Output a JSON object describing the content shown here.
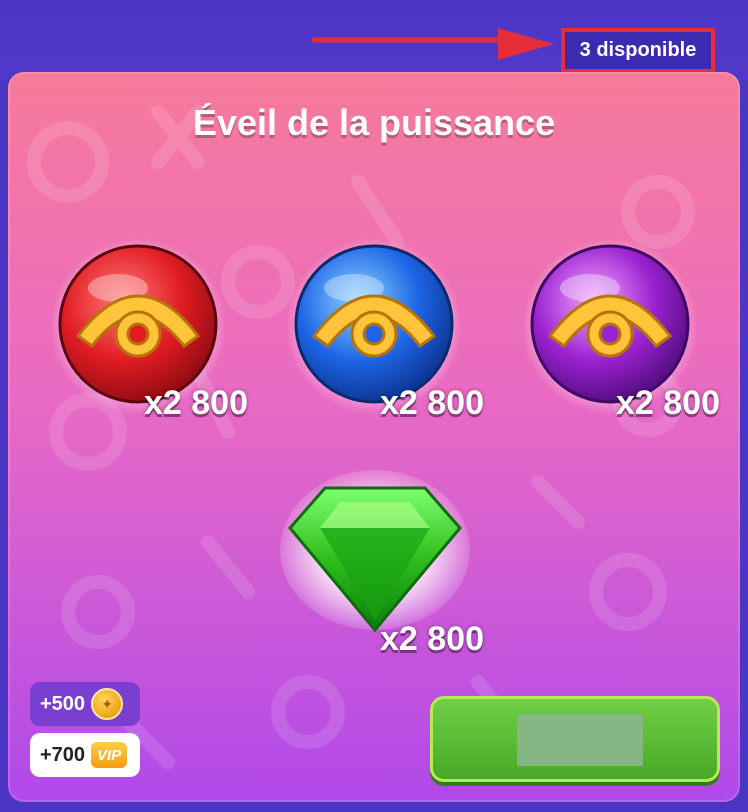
{
  "header": {
    "available_badge": "3 disponible"
  },
  "modal": {
    "title": "Éveil de la puissance",
    "rewards": [
      {
        "item": "red-eye-orb",
        "amount": "x2 800"
      },
      {
        "item": "blue-eye-orb",
        "amount": "x2 800"
      },
      {
        "item": "purple-eye-orb",
        "amount": "x2 800"
      },
      {
        "item": "green-gem",
        "amount": "x2 800"
      }
    ],
    "bonuses": [
      {
        "value": "+500",
        "icon": "gift-coin-icon"
      },
      {
        "value": "+700",
        "icon": "vip-icon"
      }
    ],
    "claim_button_label": ""
  },
  "colors": {
    "accent_red": "#e62d3a",
    "button_green": "#5bbb33"
  }
}
